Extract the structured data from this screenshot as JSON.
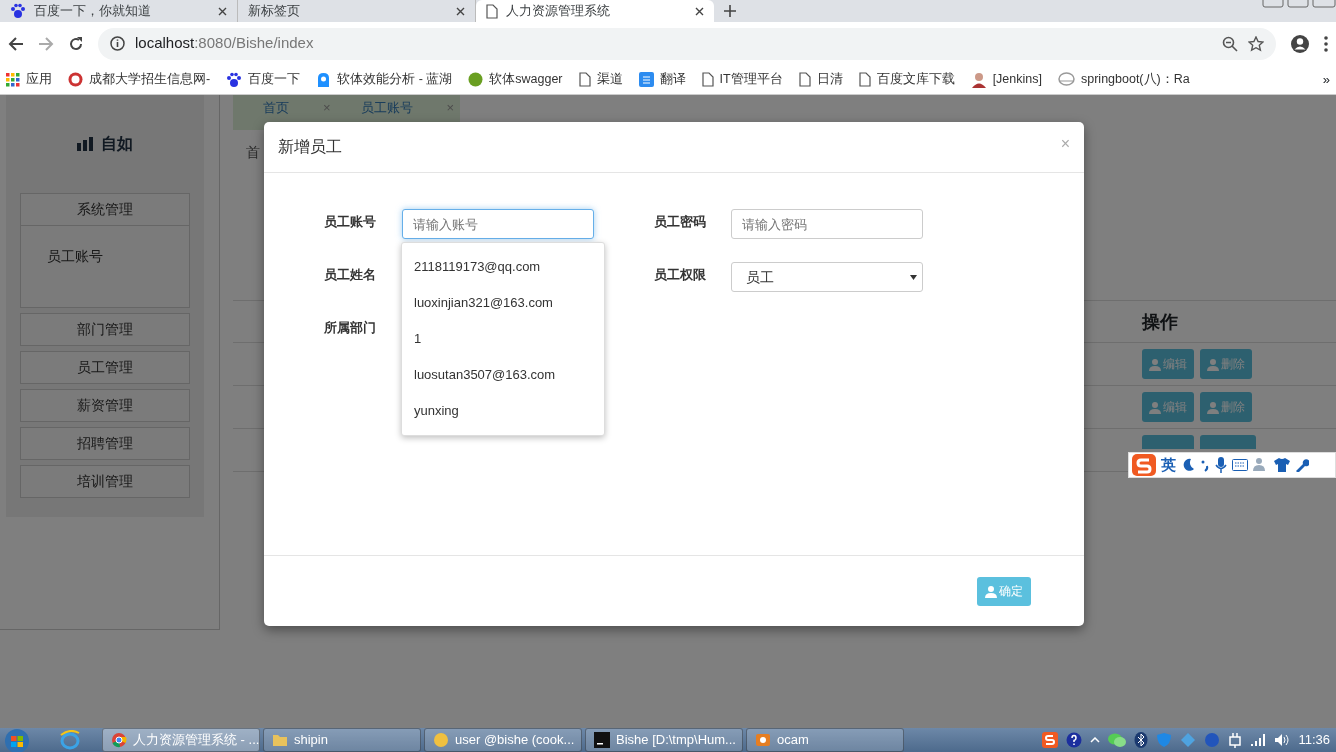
{
  "browser": {
    "tabs": [
      {
        "title": "百度一下，你就知道",
        "selected": false
      },
      {
        "title": "新标签页",
        "selected": false
      },
      {
        "title": "人力资源管理系统",
        "selected": true
      }
    ],
    "address": {
      "host": "localhost",
      "path": ":8080/Bishe/index"
    },
    "bookmarks": [
      {
        "label": "应用"
      },
      {
        "label": "成都大学招生信息网-"
      },
      {
        "label": "百度一下"
      },
      {
        "label": "软体效能分析 - 蓝湖"
      },
      {
        "label": "软体swagger"
      },
      {
        "label": "渠道"
      },
      {
        "label": "翻译"
      },
      {
        "label": "IT管理平台"
      },
      {
        "label": "日清"
      },
      {
        "label": "百度文库下载"
      },
      {
        "label": "[Jenkins]"
      },
      {
        "label": "springboot(八)：Ra"
      }
    ],
    "overflow": "»"
  },
  "app": {
    "logo": "自如",
    "menu": [
      {
        "label": "系统管理",
        "children": [
          {
            "label": "员工账号"
          }
        ]
      },
      {
        "label": "部门管理"
      },
      {
        "label": "员工管理"
      },
      {
        "label": "薪资管理"
      },
      {
        "label": "招聘管理"
      },
      {
        "label": "培训管理"
      }
    ],
    "page_tabs": [
      {
        "label": "首页",
        "close": "×"
      },
      {
        "label": "员工账号",
        "close": "×"
      }
    ],
    "breadcrumb": "首",
    "table": {
      "header": "操作",
      "rows": [
        {
          "kind": "full",
          "actions": [
            "编辑",
            "删除"
          ]
        },
        {
          "kind": "full",
          "actions": [
            "编辑",
            "删除"
          ]
        },
        {
          "kind": "cut"
        }
      ]
    }
  },
  "modal": {
    "title": "新增员工",
    "close": "×",
    "fields": [
      {
        "label": "员工账号",
        "kind": "input",
        "placeholder": "请输入账号",
        "focused": true
      },
      {
        "label": "员工密码",
        "kind": "input",
        "placeholder": "请输入密码",
        "focused": false
      },
      {
        "label": "员工姓名",
        "kind": "covered"
      },
      {
        "label": "员工权限",
        "kind": "select",
        "value": "员工"
      },
      {
        "label": "所属部门",
        "kind": "covered"
      }
    ],
    "suggestions": [
      "2118119173@qq.com",
      "luoxinjian321@163.com",
      "1",
      "luosutan3507@163.com",
      "yunxing"
    ],
    "confirm": "确定"
  },
  "ime": {
    "mode": "英"
  },
  "taskbar": {
    "items": [
      {
        "label": "人力资源管理系统 - ...",
        "selected": true
      },
      {
        "label": "shipin",
        "selected": false
      },
      {
        "label": "user @bishe (cook...",
        "selected": false
      },
      {
        "label": "Bishe [D:\\tmp\\Hum...",
        "selected": false
      },
      {
        "label": "ocam",
        "selected": false
      }
    ],
    "time": "11:36"
  }
}
